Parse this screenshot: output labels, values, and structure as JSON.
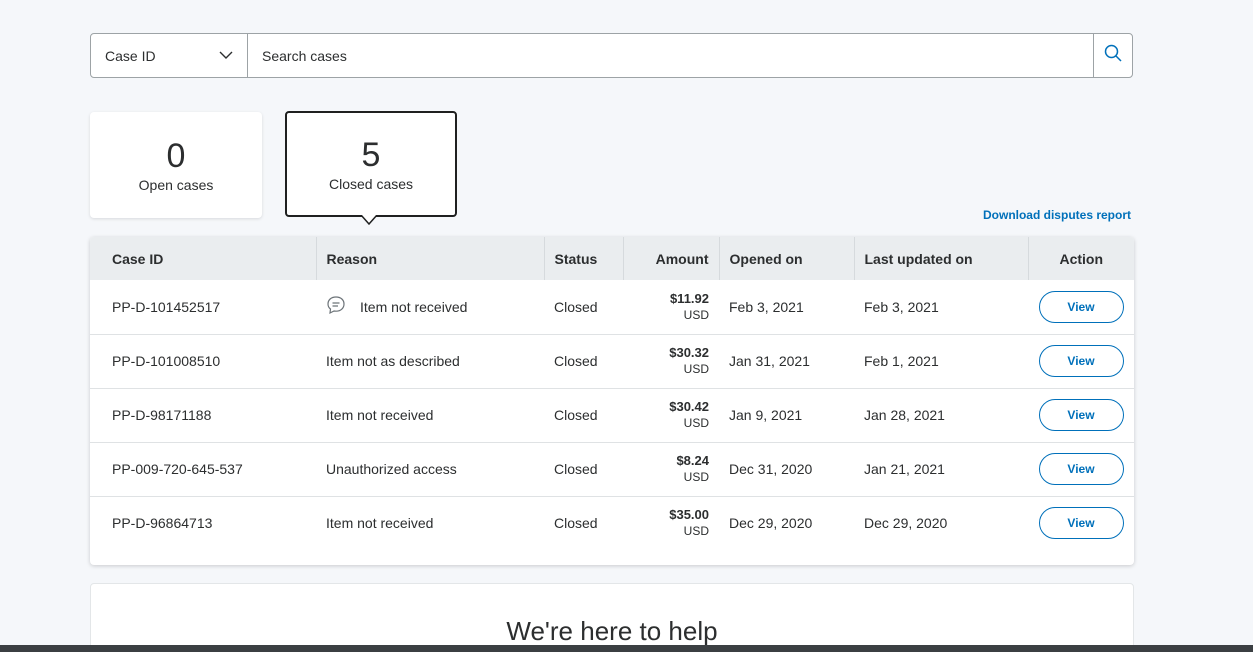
{
  "search": {
    "filter_selected": "Case ID",
    "placeholder": "Search cases"
  },
  "summary": {
    "open": {
      "count": "0",
      "label": "Open cases"
    },
    "closed": {
      "count": "5",
      "label": "Closed cases"
    }
  },
  "download_link": "Download disputes report",
  "table": {
    "headers": {
      "case_id": "Case ID",
      "reason": "Reason",
      "status": "Status",
      "amount": "Amount",
      "opened_on": "Opened on",
      "last_updated_on": "Last updated on",
      "action": "Action"
    },
    "rows": [
      {
        "case_id": "PP-D-101452517",
        "reason": "Item not received",
        "has_message_icon": true,
        "status": "Closed",
        "amount": "$11.92",
        "currency": "USD",
        "opened_on": "Feb 3, 2021",
        "last_updated_on": "Feb 3, 2021",
        "action": "View"
      },
      {
        "case_id": "PP-D-101008510",
        "reason": "Item not as described",
        "has_message_icon": false,
        "status": "Closed",
        "amount": "$30.32",
        "currency": "USD",
        "opened_on": "Jan 31, 2021",
        "last_updated_on": "Feb 1, 2021",
        "action": "View"
      },
      {
        "case_id": "PP-D-98171188",
        "reason": "Item not received",
        "has_message_icon": false,
        "status": "Closed",
        "amount": "$30.42",
        "currency": "USD",
        "opened_on": "Jan 9, 2021",
        "last_updated_on": "Jan 28, 2021",
        "action": "View"
      },
      {
        "case_id": "PP-009-720-645-537",
        "reason": "Unauthorized access",
        "has_message_icon": false,
        "status": "Closed",
        "amount": "$8.24",
        "currency": "USD",
        "opened_on": "Dec 31, 2020",
        "last_updated_on": "Jan 21, 2021",
        "action": "View"
      },
      {
        "case_id": "PP-D-96864713",
        "reason": "Item not received",
        "has_message_icon": false,
        "status": "Closed",
        "amount": "$35.00",
        "currency": "USD",
        "opened_on": "Dec 29, 2020",
        "last_updated_on": "Dec 29, 2020",
        "action": "View"
      }
    ]
  },
  "help": {
    "title": "We're here to help"
  },
  "icons": {
    "filter_chevron": "chevron-down-icon",
    "search": "search-icon",
    "message": "message-bubble-icon"
  },
  "colors": {
    "link": "#0070ba",
    "background": "#f5f7fa",
    "header_row": "#eaedef"
  }
}
